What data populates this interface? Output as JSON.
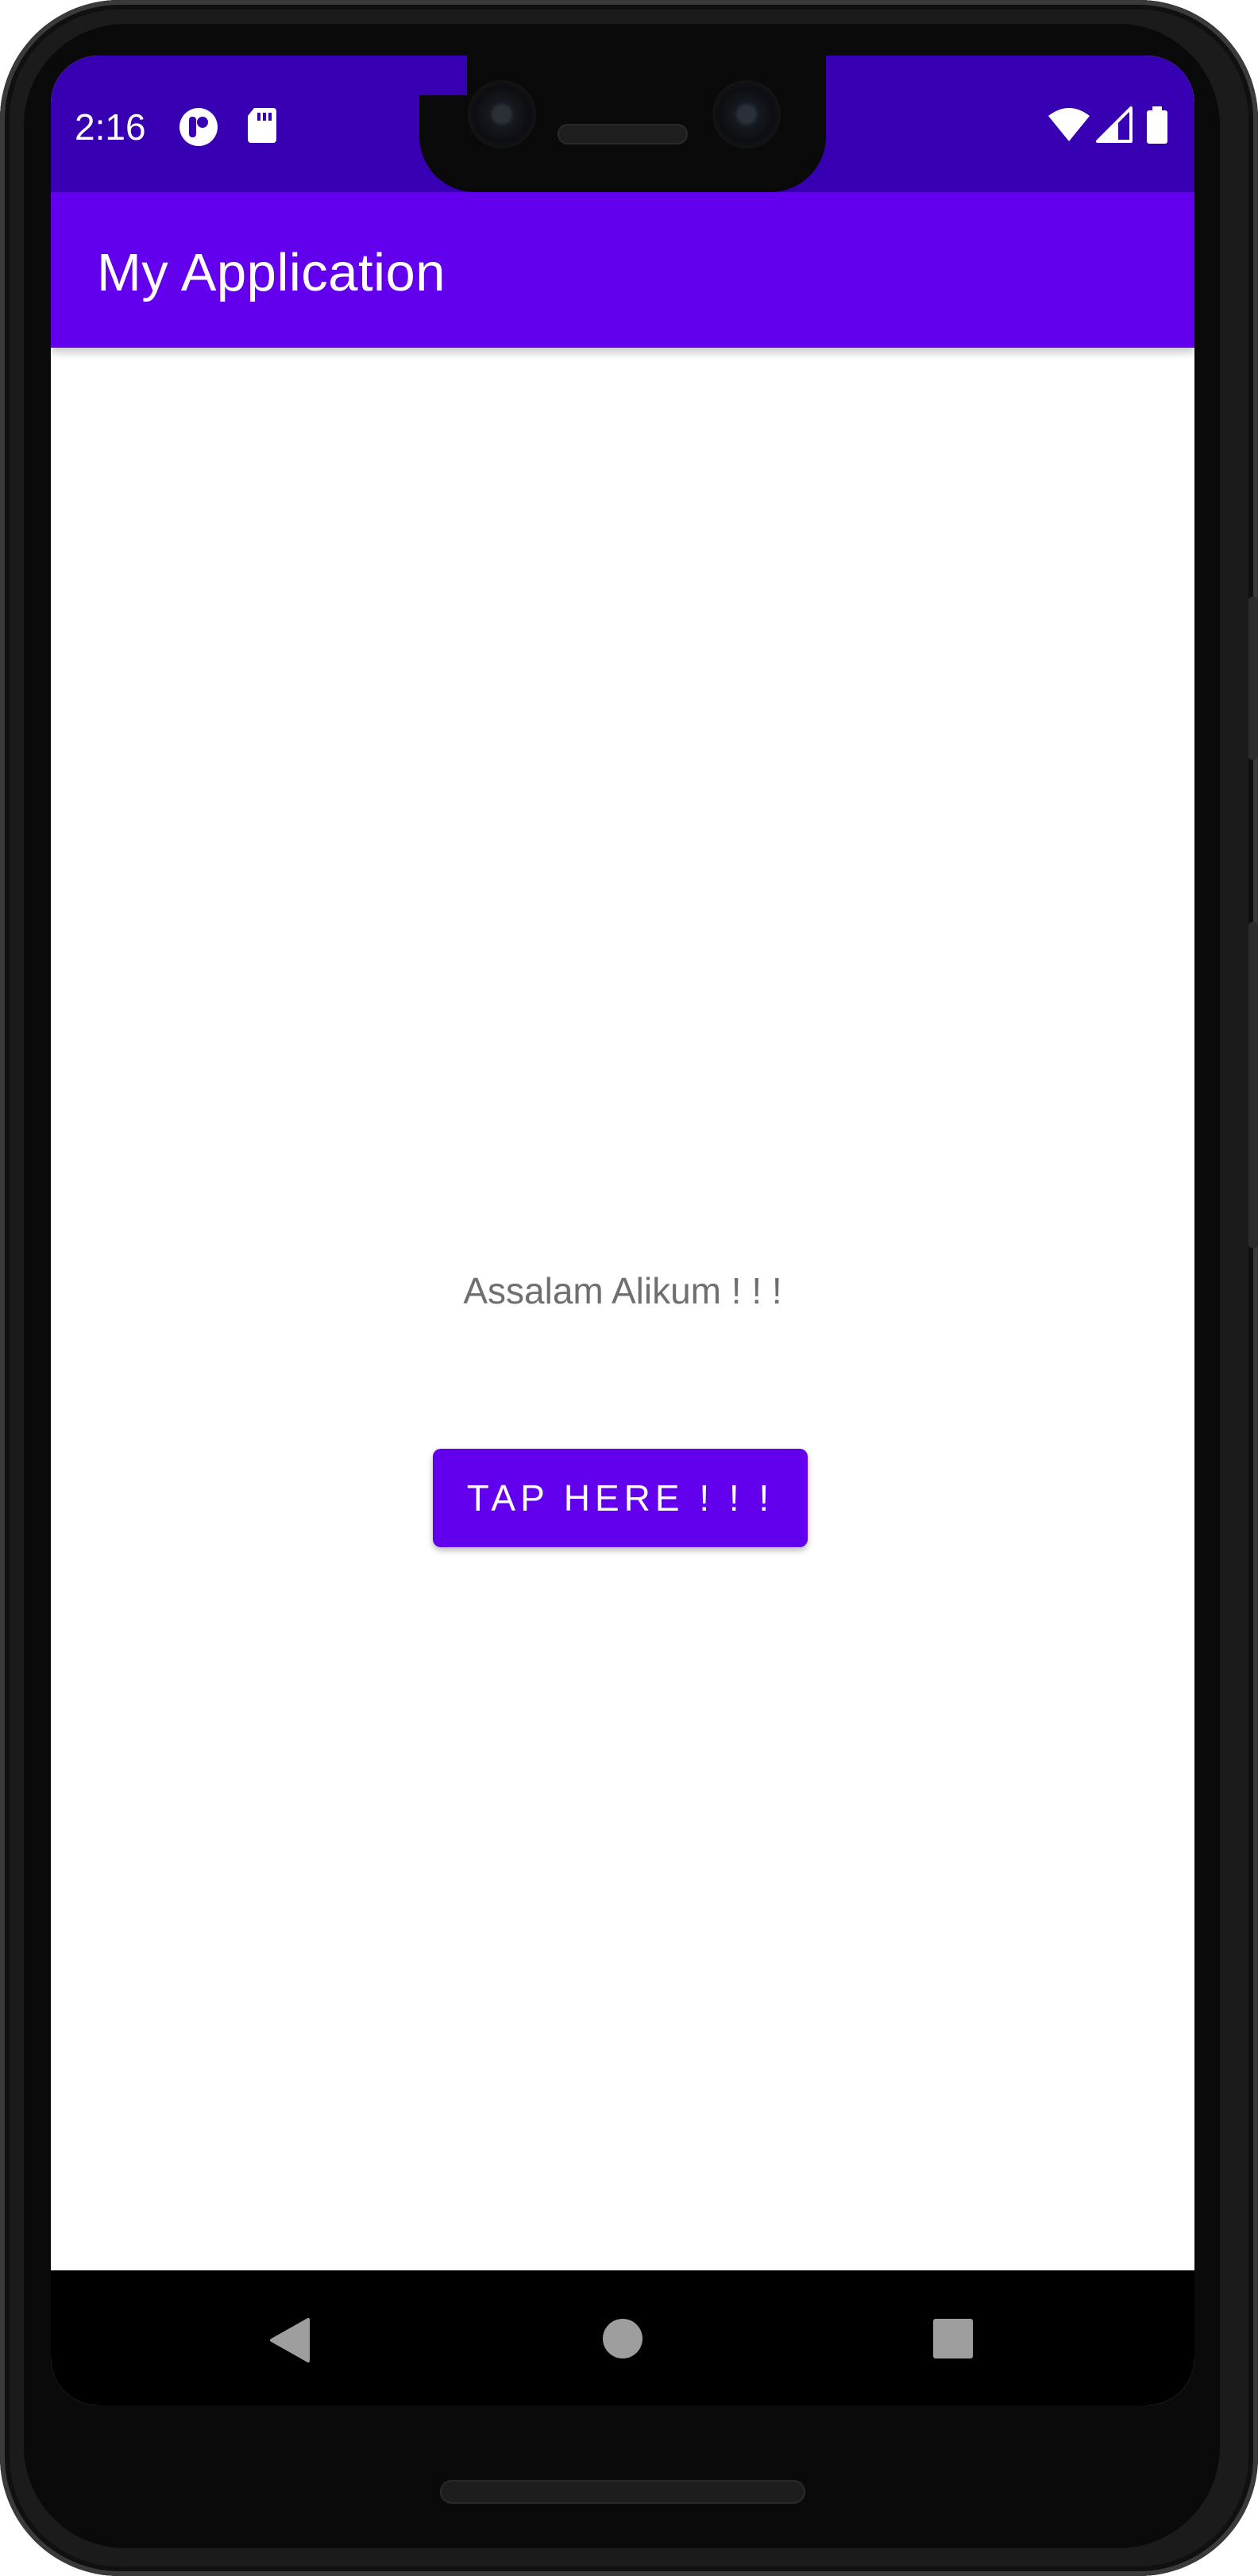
{
  "status_bar": {
    "time": "2:16",
    "background_color": "#3700b3",
    "left_icons": [
      "ring-app-icon",
      "sd-card-icon"
    ],
    "right_icons": [
      "wifi-icon",
      "cell-signal-icon",
      "battery-icon"
    ]
  },
  "app_bar": {
    "title": "My Application",
    "background_color": "#6200ee"
  },
  "main": {
    "greeting_text": "Assalam Alikum ! ! !",
    "button_label": "TAP HERE ! ! !",
    "button_color": "#6200ee"
  },
  "nav_bar": {
    "icons": [
      "back-icon",
      "home-icon",
      "recents-icon"
    ]
  }
}
